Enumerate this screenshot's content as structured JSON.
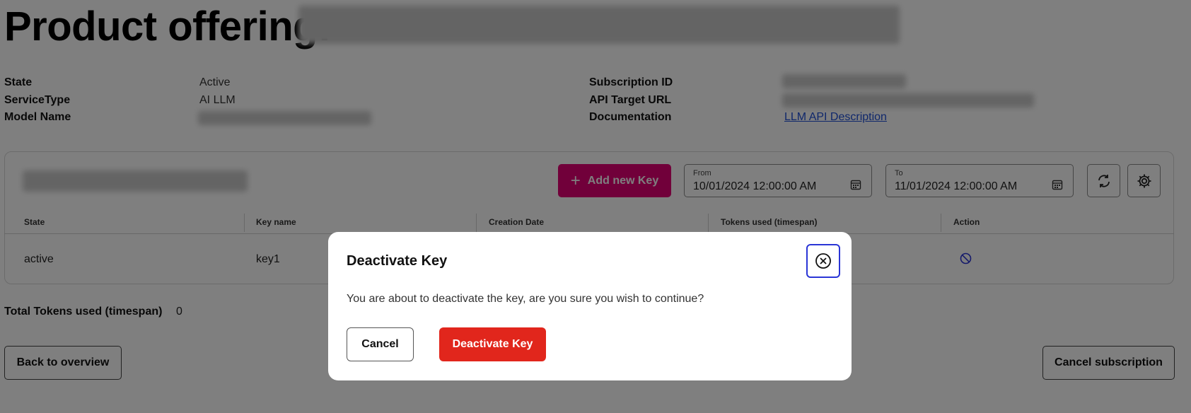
{
  "header": {
    "title": "Product offering:"
  },
  "details": {
    "state_label": "State",
    "state_value": "Active",
    "service_type_label": "ServiceType",
    "service_type_value": "AI LLM",
    "model_name_label": "Model Name",
    "subscription_id_label": "Subscription ID",
    "api_target_url_label": "API Target URL",
    "documentation_label": "Documentation",
    "documentation_link": "LLM API Description"
  },
  "keys_panel": {
    "add_key_label": "Add new Key",
    "from_label": "From",
    "from_value": "10/01/2024 12:00:00 AM",
    "to_label": "To",
    "to_value": "11/01/2024 12:00:00 AM",
    "refresh_icon": "refresh-icon",
    "settings_icon": "gear-icon",
    "columns": [
      "State",
      "Key name",
      "Creation Date",
      "Tokens used (timespan)",
      "Action"
    ],
    "rows": [
      {
        "state": "active",
        "key_name": "key1",
        "action_icon": "block-icon"
      }
    ]
  },
  "totals": {
    "label": "Total Tokens used (timespan)",
    "value": "0"
  },
  "footer": {
    "back_label": "Back to overview",
    "cancel_subscription_label": "Cancel subscription"
  },
  "modal": {
    "title": "Deactivate Key",
    "message": "You are about to deactivate the key, are you sure you wish to continue?",
    "cancel_label": "Cancel",
    "confirm_label": "Deactivate Key",
    "close_icon": "close-circle-icon"
  },
  "colors": {
    "brand_magenta": "#e20074",
    "danger_red": "#e1261c",
    "focus_blue": "#2a35d6",
    "link_blue": "#1f4fd6"
  }
}
